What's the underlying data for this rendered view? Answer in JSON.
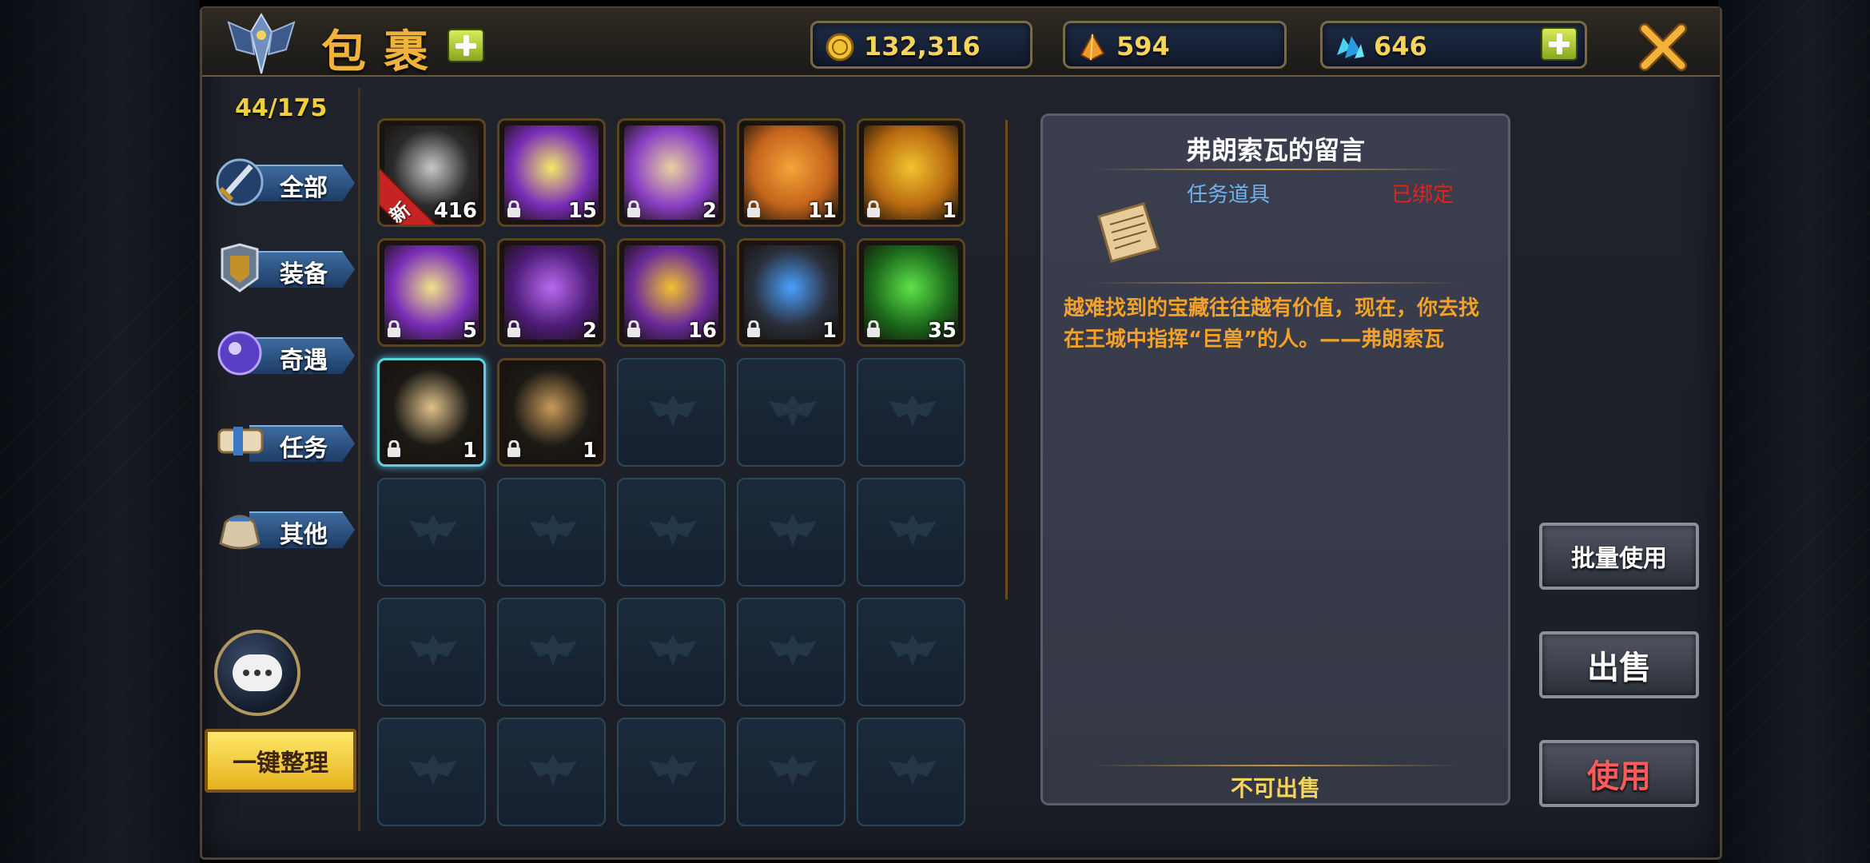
{
  "header": {
    "title": "包裹",
    "capacity": "44/175"
  },
  "resources": {
    "gold": "132,316",
    "crystal": "594",
    "gem": "646"
  },
  "categories": [
    {
      "label": "全部",
      "icon": "sword-shield-icon"
    },
    {
      "label": "装备",
      "icon": "armor-icon"
    },
    {
      "label": "奇遇",
      "icon": "magic-orb-icon"
    },
    {
      "label": "任务",
      "icon": "scroll-icon"
    },
    {
      "label": "其他",
      "icon": "pouch-icon"
    }
  ],
  "sort_button": "一键整理",
  "items": [
    {
      "name": "silver-ore",
      "qty": "416",
      "new": true,
      "new_label": "新",
      "color": "#c8c8c8",
      "bg": "#2a2a2a"
    },
    {
      "name": "potion-tube",
      "qty": "15",
      "color": "#f4e86a",
      "bg": "#7a2db8"
    },
    {
      "name": "candy-box",
      "qty": "2",
      "color": "#e8d2a0",
      "bg": "#8a3ec4"
    },
    {
      "name": "amber-ore",
      "qty": "11",
      "color": "#f3a53a",
      "bg": "#c4641c"
    },
    {
      "name": "mystery-armor",
      "qty": "1",
      "color": "#f2c230",
      "bg": "#b86a10"
    },
    {
      "name": "yellow-potion",
      "qty": "5",
      "color": "#f1e28a",
      "bg": "#7a2db8"
    },
    {
      "name": "purple-crystal",
      "qty": "2",
      "color": "#b86aee",
      "bg": "#4e1c78"
    },
    {
      "name": "mystery-armor-2",
      "qty": "16",
      "color": "#f2c230",
      "bg": "#6a2a9a"
    },
    {
      "name": "exp-book",
      "qty": "1",
      "color": "#4aa0ff",
      "bg": "#2a2f3a"
    },
    {
      "name": "green-crystal",
      "qty": "35",
      "color": "#5fe24a",
      "bg": "#1c6a1c"
    },
    {
      "name": "parchment",
      "qty": "1",
      "color": "#e0c28a",
      "bg": "#1c1a16",
      "selected": true
    },
    {
      "name": "old-book",
      "qty": "1",
      "color": "#c89a5a",
      "bg": "#1c1a16"
    }
  ],
  "detail": {
    "title": "弗朗索瓦的留言",
    "type": "任务道具",
    "bound": "已绑定",
    "description": "越难找到的宝藏往往越有价值，现在，你去找在王城中指挥“巨兽”的人。——弗朗索瓦",
    "footer": "不可出售"
  },
  "actions": {
    "batch_use": "批量使用",
    "sell": "出售",
    "use": "使用"
  }
}
